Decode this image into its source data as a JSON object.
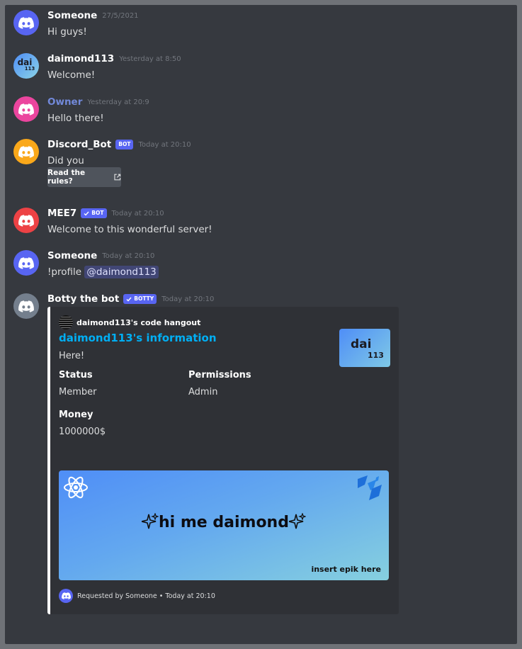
{
  "colors": {
    "blurple": "#5865f2",
    "owner_name": "#7289da",
    "link": "#00aff4"
  },
  "messages": [
    {
      "author": "Someone",
      "timestamp": "27/5/2021",
      "text": "Hi guys!",
      "avatar": "discord-logo-icon",
      "avatar_color": "#5865f2"
    },
    {
      "author": "daimond113",
      "timestamp": "Yesterday at 8:50",
      "text": "Welcome!",
      "avatar_text": "dai",
      "avatar_sub": "113"
    },
    {
      "author": "Owner",
      "timestamp": "Yesterday at 20:9",
      "text": "Hello there!",
      "avatar": "discord-logo-icon",
      "avatar_color": "#eb459e"
    },
    {
      "author": "Discord_Bot",
      "tag": "BOT",
      "timestamp": "Today at 20:10",
      "text": "Did you",
      "button": "Read the rules?",
      "button_icon": "external-link-icon",
      "avatar": "discord-logo-icon",
      "avatar_color": "#faa81a"
    },
    {
      "author": "MEE7",
      "tag": "BOT",
      "timestamp": "Today at 20:10",
      "text": "Welcome to this wonderful server!",
      "avatar": "discord-logo-icon",
      "avatar_color": "#ed4245"
    },
    {
      "author": "Someone",
      "timestamp": "Today at 20:10",
      "text": "!profile",
      "mention": "@daimond113",
      "avatar": "discord-logo-icon",
      "avatar_color": "#5865f2"
    },
    {
      "author": "Botty the bot",
      "tag": "BOTTY",
      "timestamp": "Today at 20:10",
      "avatar": "discord-logo-icon",
      "avatar_color": "#747f8d"
    }
  ],
  "embed": {
    "author": "daimond113's code hangout",
    "title": "daimond113's information",
    "description": "Here!",
    "thumbnail_text": "dai",
    "thumbnail_sub": "113",
    "fields": [
      {
        "name": "Status",
        "value": "Member"
      },
      {
        "name": "Permissions",
        "value": "Admin"
      },
      {
        "name": "Money",
        "value": "1000000$"
      }
    ],
    "image_text": "hi me daimond",
    "image_caption": "insert epik here",
    "footer": "Requested by Someone • Today at 20:10"
  }
}
